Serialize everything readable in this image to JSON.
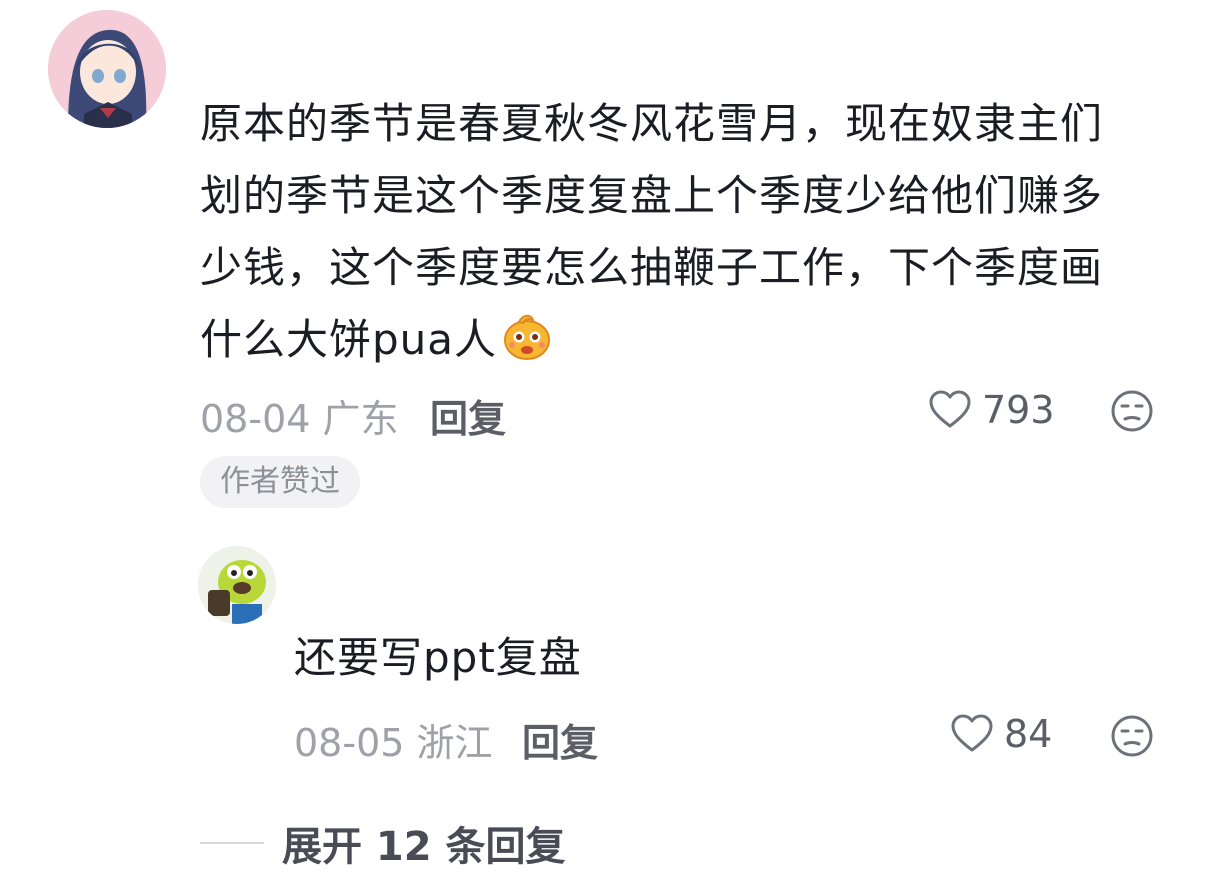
{
  "main_comment": {
    "text_lines": [
      "原本的季节是春夏秋冬风花雪月，现在奴隶主们",
      "划的季节是这个季度复盘上个季度少给他们赚多",
      "少钱，这个季度要怎么抽鞭子工作，下个季度画",
      "什么大饼pua人"
    ],
    "emoji": "surprised-face-emoji",
    "date_location": "08-04 广东",
    "reply_label": "回复",
    "like_count": "793",
    "author_liked_badge": "作者赞过"
  },
  "reply_comment": {
    "text": "还要写ppt复盘",
    "date_location": "08-05 浙江",
    "reply_label": "回复",
    "like_count": "84"
  },
  "expand": {
    "label": "展开 12 条回复"
  }
}
